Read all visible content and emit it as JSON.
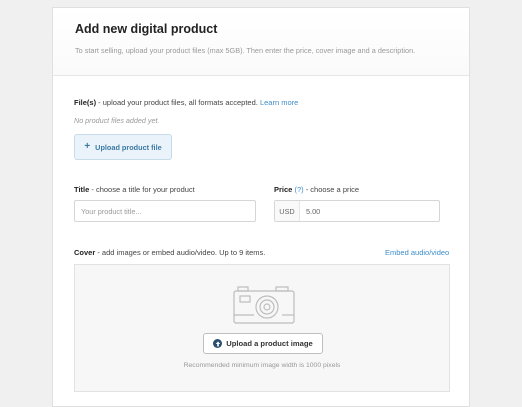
{
  "header": {
    "title": "Add new digital product",
    "subtitle": "To start selling, upload your product files (max 5GB). Then enter the price, cover image and a description."
  },
  "files": {
    "label_bold": "File(s)",
    "label_rest": " - upload your product files, all formats accepted. ",
    "learn_more": "Learn more",
    "empty_text": "No product files added yet.",
    "upload_button": "Upload product file"
  },
  "title_field": {
    "label_bold": "Title",
    "label_rest": " - choose a title for your product",
    "placeholder": "Your product title..."
  },
  "price_field": {
    "label_bold": "Price",
    "help": "(?)",
    "label_rest": " - choose a price",
    "currency": "USD",
    "value": "5.00"
  },
  "cover": {
    "label_bold": "Cover",
    "label_rest": " - add images or embed audio/video. Up to 9 items.",
    "embed_link": "Embed audio/video",
    "upload_button": "Upload a product image",
    "hint": "Recommended minimum image width is 1000 pixels",
    "icons": {
      "camera": "camera-icon",
      "upload": "upload-arrow-icon",
      "plus": "plus-icon"
    }
  },
  "colors": {
    "link": "#3d8ec9",
    "accent_button_bg": "#e9f3f9"
  }
}
